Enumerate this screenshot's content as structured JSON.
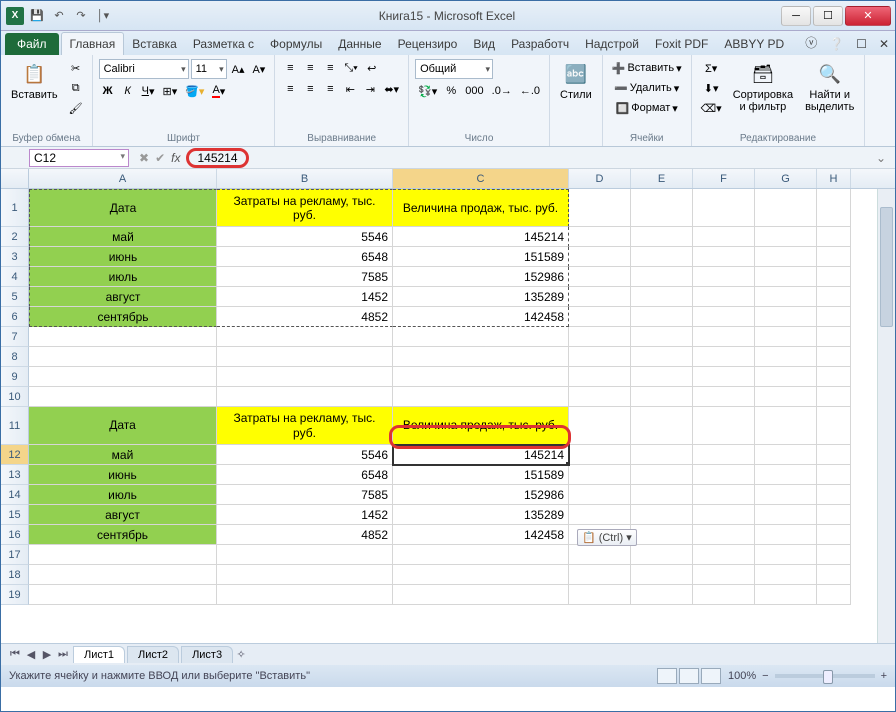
{
  "title": "Книга15 - Microsoft Excel",
  "tabs": {
    "file": "Файл",
    "list": [
      "Главная",
      "Вставка",
      "Разметка с",
      "Формулы",
      "Данные",
      "Рецензиро",
      "Вид",
      "Разработч",
      "Надстрой",
      "Foxit PDF",
      "ABBYY PD"
    ],
    "active": 0
  },
  "ribbon": {
    "clipboard": {
      "paste": "Вставить",
      "label": "Буфер обмена"
    },
    "font": {
      "name": "Calibri",
      "size": "11",
      "label": "Шрифт"
    },
    "align": {
      "label": "Выравнивание"
    },
    "number": {
      "format": "Общий",
      "label": "Число"
    },
    "styles": {
      "btn": "Стили"
    },
    "cells": {
      "insert": "Вставить",
      "delete": "Удалить",
      "format": "Формат",
      "label": "Ячейки"
    },
    "editing": {
      "sort": "Сортировка\nи фильтр",
      "find": "Найти и\nвыделить",
      "label": "Редактирование"
    }
  },
  "namebox": "C12",
  "formula": "145214",
  "columns": [
    "A",
    "B",
    "C",
    "D",
    "E",
    "F",
    "G",
    "H"
  ],
  "table": {
    "headers": [
      "Дата",
      "Затраты на рекламу, тыс. руб.",
      "Величина продаж, тыс. руб."
    ],
    "rows": [
      {
        "date": "май",
        "ad": "5546",
        "sales": "145214"
      },
      {
        "date": "июнь",
        "ad": "6548",
        "sales": "151589"
      },
      {
        "date": "июль",
        "ad": "7585",
        "sales": "152986"
      },
      {
        "date": "август",
        "ad": "1452",
        "sales": "135289"
      },
      {
        "date": "сентябрь",
        "ad": "4852",
        "sales": "142458"
      }
    ]
  },
  "pasteOptions": "(Ctrl) ▾",
  "sheets": [
    "Лист1",
    "Лист2",
    "Лист3"
  ],
  "status": "Укажите ячейку и нажмите ВВОД или выберите \"Вставить\"",
  "zoom": "100%"
}
